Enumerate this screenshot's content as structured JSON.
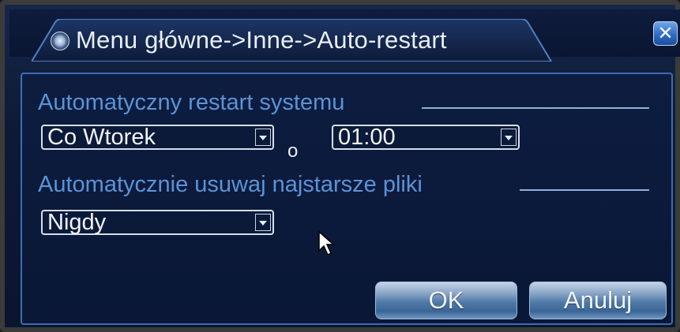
{
  "dialog": {
    "title": "Menu główne->Inne->Auto-restart",
    "close_label": "✕"
  },
  "auto_restart": {
    "section_label": "Automatyczny restart systemu",
    "day_value": "Co Wtorek",
    "separator": "o",
    "time_value": "01:00"
  },
  "delete_files": {
    "section_label": "Automatycznie usuwaj najstarsze pliki",
    "value": "Nigdy"
  },
  "buttons": {
    "ok": "OK",
    "cancel": "Anuluj"
  },
  "icons": {
    "title": "settings-dial-icon",
    "close": "close-icon",
    "dropdown": "chevron-down-icon",
    "cursor": "mouse-pointer-icon"
  },
  "colors": {
    "background": "#0d1a36",
    "section_label": "#5b93d6",
    "frame_border": "#3e6db0",
    "close_button": "#2f6cc4"
  }
}
